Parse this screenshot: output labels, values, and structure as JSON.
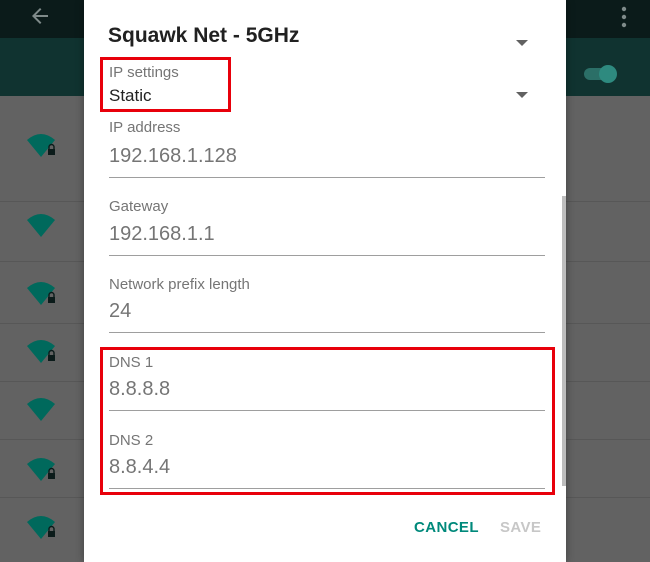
{
  "background": {
    "icons": {
      "back": "arrow-back-icon",
      "menu": "more-vert-icon",
      "toggle": "wifi-toggle",
      "network": "wifi-signal-icon"
    },
    "colors": {
      "accent": "#00796b",
      "signal": "#00695c"
    }
  },
  "dialog": {
    "title": "Squawk Net - 5GHz",
    "ip_settings": {
      "label": "IP settings",
      "value": "Static"
    },
    "fields": [
      {
        "label": "IP address",
        "value": "192.168.1.128"
      },
      {
        "label": "Gateway",
        "value": "192.168.1.1"
      },
      {
        "label": "Network prefix length",
        "value": "24"
      },
      {
        "label": "DNS 1",
        "value": "8.8.8.8"
      },
      {
        "label": "DNS 2",
        "value": "8.8.4.4"
      }
    ],
    "buttons": {
      "cancel": "CANCEL",
      "save": "SAVE"
    },
    "colors": {
      "button": "#00897b",
      "disabled": "#c7c7c7",
      "highlight": "#e8000b"
    }
  }
}
